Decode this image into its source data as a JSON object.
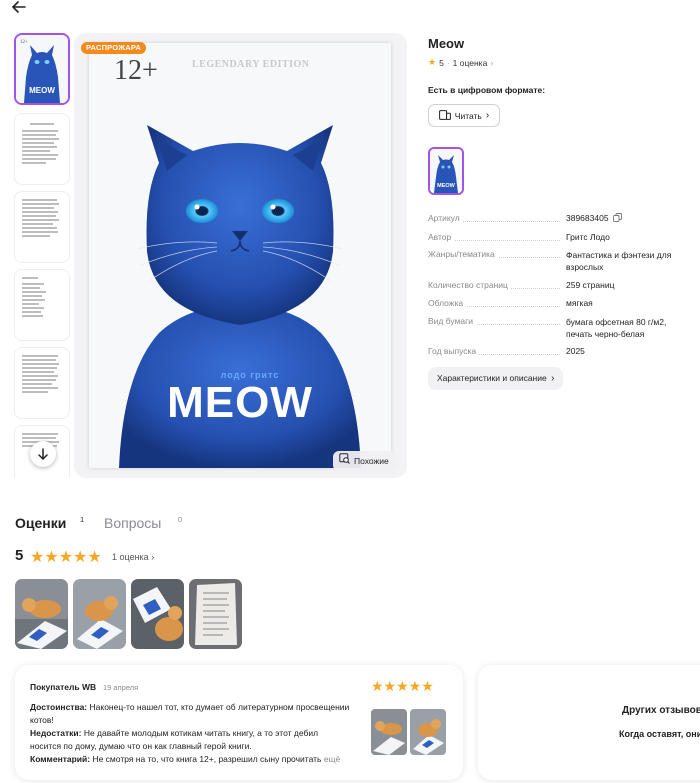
{
  "product": {
    "title": "Meow",
    "rating": "5",
    "reviews_count": "1 оценка",
    "sale_badge": "РАСПРОЖАРА",
    "similar_label": "Похожие",
    "digital_label": "Есть в цифровом формате:",
    "read_label": "Читать",
    "char_button": "Характеристики и описание"
  },
  "cover": {
    "age": "12+",
    "edition": "LEGENDARY EDITION",
    "author_line": "лодо   гритс",
    "title": "MEOW"
  },
  "specs": [
    {
      "key": "Артикул",
      "value": "389683405"
    },
    {
      "key": "Автор",
      "value": "Гритс Лодо"
    },
    {
      "key": "Жанры/тематика",
      "value": "Фантастика и фэнтези для взрослых"
    },
    {
      "key": "Количество страниц",
      "value": "259 страниц"
    },
    {
      "key": "Обложка",
      "value": "мягкая"
    },
    {
      "key": "Вид бумаги",
      "value": "бумага офсетная 80 г/м2, печать черно-белая"
    },
    {
      "key": "Год выпуска",
      "value": "2025"
    }
  ],
  "tabs": {
    "ratings": "Оценки",
    "ratings_count": "1",
    "questions": "Вопросы",
    "questions_count": "0"
  },
  "summary": {
    "score": "5",
    "count": "1 оценка"
  },
  "review": {
    "author": "Покупатель WB",
    "date": "19 апреля",
    "pros_label": "Достоинства:",
    "pros": "Наконец-то нашел тот, кто думает об литературном просвещении котов!",
    "cons_label": "Недостатки:",
    "cons": "Не давайте молодым котикам читать книгу, а то этот дебил носится по дому, думаю что он как главный герой книги.",
    "comment_label": "Комментарий:",
    "comment": "Не смотря на то, что книга 12+, разрешил сыну прочитать",
    "more": "ещё"
  },
  "other_reviews": {
    "title": "Других отзывов",
    "subtitle": "Когда оставят, они"
  },
  "colors": {
    "accent": "#a155e8",
    "star": "#f6a723",
    "sale": "#f38a1b",
    "cover_blue": "#2d5cc2"
  }
}
